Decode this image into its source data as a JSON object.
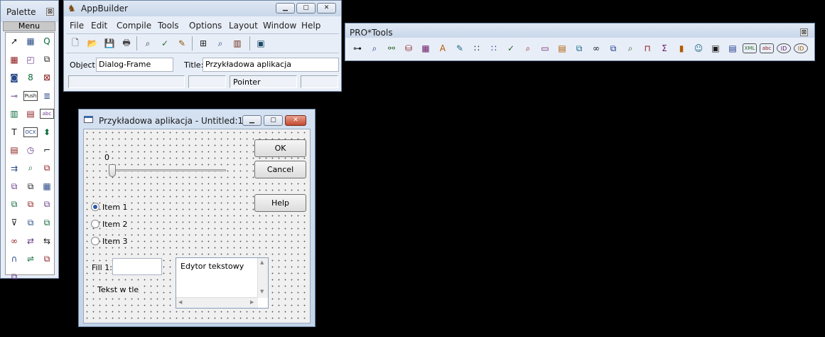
{
  "palette": {
    "title": "Palette",
    "close": "⊠",
    "menu_label": "Menu",
    "tools": [
      {
        "icon": "pointer-icon",
        "glyph": "➚"
      },
      {
        "icon": "widgets-icon",
        "glyph": "▦"
      },
      {
        "icon": "query-icon",
        "glyph": "Q"
      },
      {
        "icon": "browse-icon",
        "glyph": "▦"
      },
      {
        "icon": "frame-icon",
        "glyph": "◰"
      },
      {
        "icon": "window-icon",
        "glyph": "⧉"
      },
      {
        "icon": "camera-icon",
        "glyph": "◙"
      },
      {
        "icon": "toggle-icon",
        "glyph": "8"
      },
      {
        "icon": "rect-icon",
        "glyph": "⊠"
      },
      {
        "icon": "slider-icon",
        "glyph": "⊸"
      },
      {
        "icon": "push-button-icon",
        "glyph": "Push"
      },
      {
        "icon": "list-icon",
        "glyph": "≣"
      },
      {
        "icon": "radio-set-icon",
        "glyph": "▥"
      },
      {
        "icon": "editor-icon",
        "glyph": "▤"
      },
      {
        "icon": "fill-in-icon",
        "glyph": "abc"
      },
      {
        "icon": "text-icon",
        "glyph": "T"
      },
      {
        "icon": "ocx-icon",
        "glyph": "OCX"
      },
      {
        "icon": "combo-icon",
        "glyph": "⬍"
      },
      {
        "icon": "selection-list-icon",
        "glyph": "▤"
      },
      {
        "icon": "timer-icon",
        "glyph": "◷"
      },
      {
        "icon": "line-icon",
        "glyph": "⌐"
      },
      {
        "icon": "sdo-icon",
        "glyph": "⇉"
      },
      {
        "icon": "wizard-icon",
        "glyph": "⌕"
      },
      {
        "icon": "smartobject-icon",
        "glyph": "⧉"
      },
      {
        "icon": "viewer-icon",
        "glyph": "⧉"
      },
      {
        "icon": "sbo-icon",
        "glyph": "⧉"
      },
      {
        "icon": "browser-icon",
        "glyph": "▦"
      },
      {
        "icon": "datalink-icon",
        "glyph": "⧉"
      },
      {
        "icon": "panel-icon",
        "glyph": "⧉"
      },
      {
        "icon": "folder-icon",
        "glyph": "⧉"
      },
      {
        "icon": "filter-icon",
        "glyph": "⊽"
      },
      {
        "icon": "toolbar-icon",
        "glyph": "⧉"
      },
      {
        "icon": "navigator-icon",
        "glyph": "⧉"
      },
      {
        "icon": "link-icon",
        "glyph": "∞"
      },
      {
        "icon": "update-icon",
        "glyph": "⇄"
      },
      {
        "icon": "transfer-icon",
        "glyph": "⇆"
      },
      {
        "icon": "magnet-icon",
        "glyph": "∩"
      },
      {
        "icon": "flow-icon",
        "glyph": "⇌"
      },
      {
        "icon": "dataview-icon",
        "glyph": "⧉"
      },
      {
        "icon": "extra-icon",
        "glyph": "⧉"
      }
    ]
  },
  "appbuilder": {
    "title": "AppBuilder",
    "menu": [
      "File",
      "Edit",
      "Compile",
      "Tools",
      "Options",
      "Layout",
      "Window",
      "Help"
    ],
    "toolbar": [
      {
        "icon": "new-file-icon",
        "glyph": "🗋"
      },
      {
        "icon": "open-folder-icon",
        "glyph": "📂"
      },
      {
        "icon": "save-icon",
        "glyph": "💾"
      },
      {
        "icon": "print-icon",
        "glyph": "🖶"
      },
      {
        "icon": "find-icon",
        "glyph": "⌕"
      },
      {
        "icon": "run-icon",
        "glyph": "✓"
      },
      {
        "icon": "edit-code-icon",
        "glyph": "✎"
      },
      {
        "icon": "hierarchy-icon",
        "glyph": "⊞"
      },
      {
        "icon": "zoom-icon",
        "glyph": "⌕"
      },
      {
        "icon": "books-icon",
        "glyph": "▥"
      },
      {
        "icon": "computer-icon",
        "glyph": "▣"
      }
    ],
    "object_label": "Object:",
    "object_value": "Dialog-Frame",
    "title_label": "Title:",
    "title_value": "Przykładowa aplikacja",
    "status_pointer": "Pointer"
  },
  "protools": {
    "title": "PRO*Tools",
    "close": "⊠",
    "tools": [
      {
        "icon": "debugger-icon",
        "glyph": "⊶"
      },
      {
        "icon": "search-icon",
        "glyph": "⌕"
      },
      {
        "icon": "tree-icon",
        "glyph": "⚯"
      },
      {
        "icon": "database-icon",
        "glyph": "⛁"
      },
      {
        "icon": "report-icon",
        "glyph": "▦"
      },
      {
        "icon": "sort-icon",
        "glyph": "A"
      },
      {
        "icon": "brush-icon",
        "glyph": "✎"
      },
      {
        "icon": "grid-icon",
        "glyph": "∷"
      },
      {
        "icon": "rule-icon",
        "glyph": "∷"
      },
      {
        "icon": "check-icon",
        "glyph": "✓"
      },
      {
        "icon": "magnify-icon",
        "glyph": "⌕"
      },
      {
        "icon": "image-icon",
        "glyph": "▭"
      },
      {
        "icon": "doc-icon",
        "glyph": "▤"
      },
      {
        "icon": "layout-icon",
        "glyph": "⧉"
      },
      {
        "icon": "link2-icon",
        "glyph": "∞"
      },
      {
        "icon": "share-icon",
        "glyph": "⧉"
      },
      {
        "icon": "inspect-icon",
        "glyph": "⌕"
      },
      {
        "icon": "pipe-icon",
        "glyph": "⊓"
      },
      {
        "icon": "sigma-icon",
        "glyph": "Σ"
      },
      {
        "icon": "column-icon",
        "glyph": "▮"
      },
      {
        "icon": "people-icon",
        "glyph": "☺"
      },
      {
        "icon": "notebook-icon",
        "glyph": "▣"
      },
      {
        "icon": "clipboard-icon",
        "glyph": "▤"
      },
      {
        "icon": "xml-icon",
        "glyph": "XML"
      },
      {
        "icon": "abc-icon",
        "glyph": "abc"
      },
      {
        "icon": "id-icon",
        "glyph": "ID"
      },
      {
        "icon": "id2-icon",
        "glyph": "ID"
      }
    ]
  },
  "dialog": {
    "title": "Przykładowa aplikacja - Untitled:1",
    "slider_value": "0",
    "ok": "OK",
    "cancel": "Cancel",
    "help": "Help",
    "radios": [
      "Item 1",
      "Item 2",
      "Item 3"
    ],
    "fill_label": "Fill 1:",
    "background_text": "Tekst w tle",
    "editor_text": "Edytor tekstowy"
  }
}
